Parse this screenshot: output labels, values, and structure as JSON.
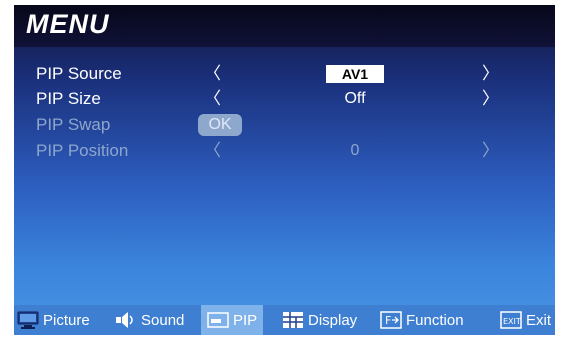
{
  "menu": {
    "title": "MENU"
  },
  "pip_rows": [
    {
      "label": "PIP Source",
      "value": "AV1",
      "left_arrow": "〈",
      "right_arrow": "〉"
    },
    {
      "label": "PIP Size",
      "value": "Off",
      "left_arrow": "〈",
      "right_arrow": "〉"
    },
    {
      "label": "PIP Swap",
      "button": "OK"
    },
    {
      "label": "PIP Position",
      "value": "0",
      "left_arrow": "〈",
      "right_arrow": "〉"
    }
  ],
  "bottom_nav": [
    {
      "label": "Picture",
      "icon": "monitor-icon"
    },
    {
      "label": "Sound",
      "icon": "speaker-icon"
    },
    {
      "label": "PIP",
      "icon": "pip-icon"
    },
    {
      "label": "Display",
      "icon": "grid-icon"
    },
    {
      "label": "Function",
      "icon": "function-icon"
    },
    {
      "label": "Exit",
      "icon": "exit-icon"
    }
  ],
  "colors": {
    "screen_top": "#12143a",
    "screen_bottom": "#4a95e3",
    "disabled_text": "#8ea6cc",
    "selected_value_bg": "#ffffff",
    "bottom_bar": "#3e7fd2",
    "bottom_active": "#7fb2ea"
  }
}
